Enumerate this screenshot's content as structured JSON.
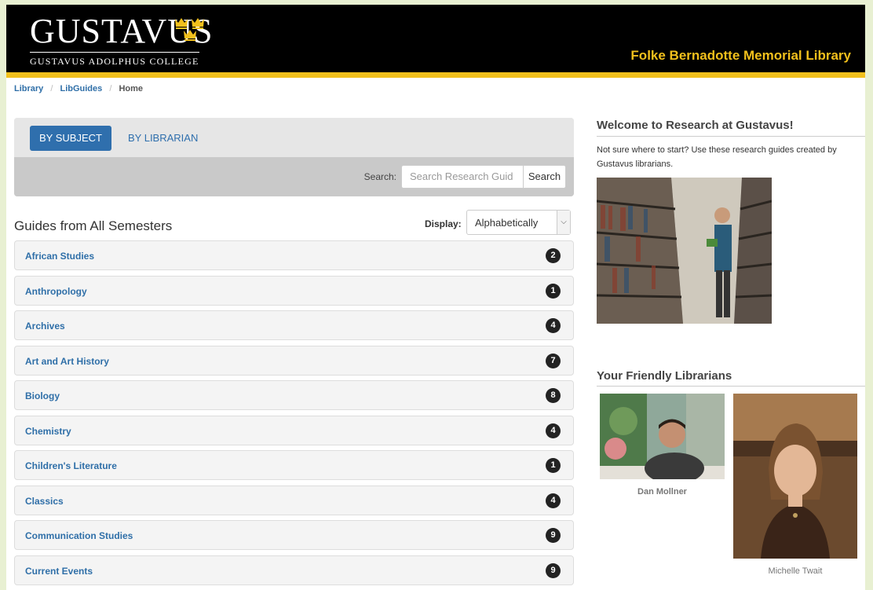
{
  "header": {
    "logo_word": "GUSTAVUS",
    "logo_sub": "GUSTAVUS ADOLPHUS COLLEGE",
    "site_title": "Folke Bernadotte Memorial Library"
  },
  "breadcrumb": {
    "items": [
      "Library",
      "LibGuides"
    ],
    "current": "Home",
    "separator": "/"
  },
  "tabs": {
    "active": "BY SUBJECT",
    "inactive": "BY LIBRARIAN"
  },
  "search": {
    "label": "Search:",
    "placeholder": "Search Research Guid",
    "button": "Search"
  },
  "guides": {
    "title": "Guides from All Semesters",
    "display_label": "Display:",
    "display_value": "Alphabetically",
    "items": [
      {
        "name": "African Studies",
        "count": "2"
      },
      {
        "name": "Anthropology",
        "count": "1"
      },
      {
        "name": "Archives",
        "count": "4"
      },
      {
        "name": "Art and Art History",
        "count": "7"
      },
      {
        "name": "Biology",
        "count": "8"
      },
      {
        "name": "Chemistry",
        "count": "4"
      },
      {
        "name": "Children's Literature",
        "count": "1"
      },
      {
        "name": "Classics",
        "count": "4"
      },
      {
        "name": "Communication Studies",
        "count": "9"
      },
      {
        "name": "Current Events",
        "count": "9"
      }
    ]
  },
  "welcome": {
    "title": "Welcome to Research at Gustavus!",
    "text": "Not sure where to start? Use these research guides created by Gustavus librarians."
  },
  "librarians": {
    "title": "Your Friendly Librarians",
    "people": [
      "Dan Mollner",
      "Michelle Twait"
    ]
  },
  "colors": {
    "brand_gold": "#f2c01c",
    "header_black": "#000000",
    "link_blue": "#2f6fa8",
    "tab_active": "#2f6fad"
  }
}
